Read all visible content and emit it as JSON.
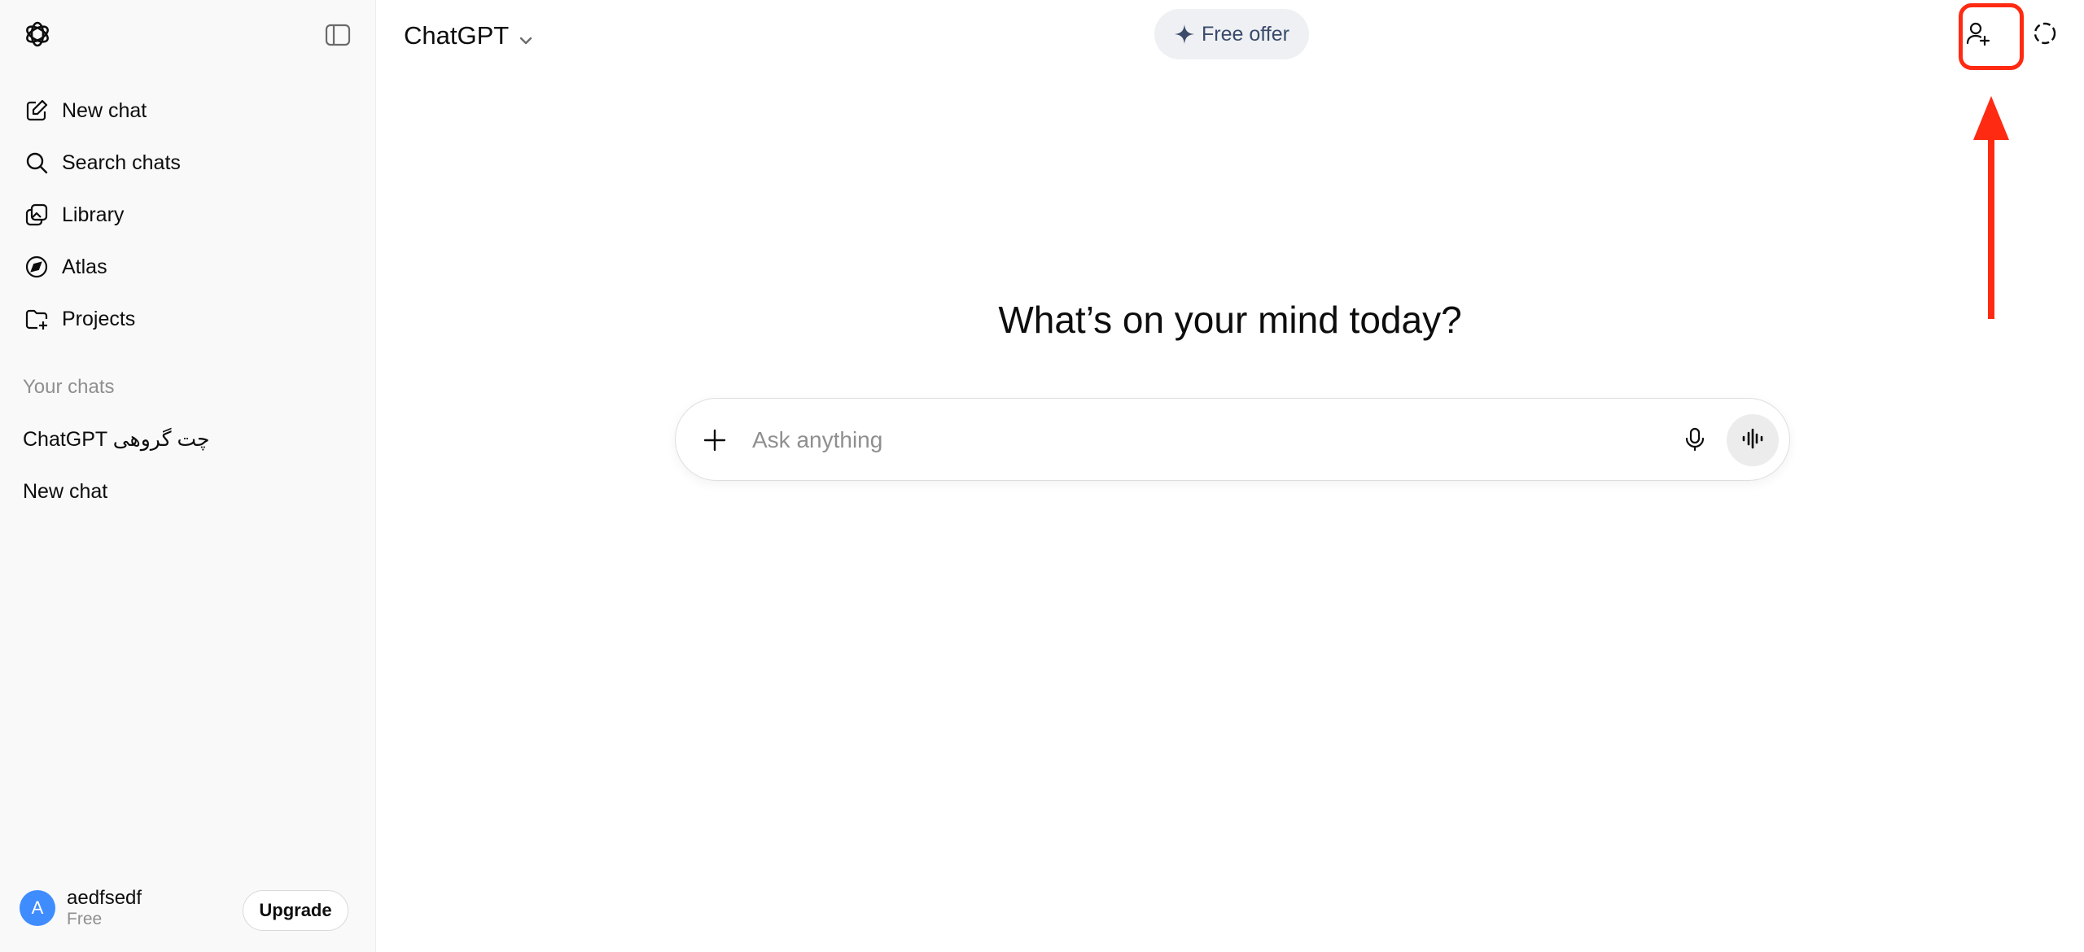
{
  "sidebar": {
    "nav": [
      {
        "label": "New chat",
        "icon": "new-chat-icon"
      },
      {
        "label": "Search chats",
        "icon": "search-icon"
      },
      {
        "label": "Library",
        "icon": "library-icon"
      },
      {
        "label": "Atlas",
        "icon": "atlas-icon"
      },
      {
        "label": "Projects",
        "icon": "folder-plus-icon"
      }
    ],
    "section_label": "Your chats",
    "chats": [
      {
        "title": "ChatGPT چت گروهی"
      },
      {
        "title": "New chat"
      }
    ],
    "user": {
      "avatar_initial": "A",
      "name": "aedfsedf",
      "plan": "Free",
      "upgrade_label": "Upgrade"
    }
  },
  "header": {
    "model_label": "ChatGPT",
    "free_offer_label": "Free offer"
  },
  "main": {
    "greeting": "What’s on your mind today?",
    "composer_placeholder": "Ask anything"
  },
  "colors": {
    "highlight": "#ff2a12",
    "avatar": "#3f8cff",
    "sidebar_bg": "#f9f9f9"
  }
}
